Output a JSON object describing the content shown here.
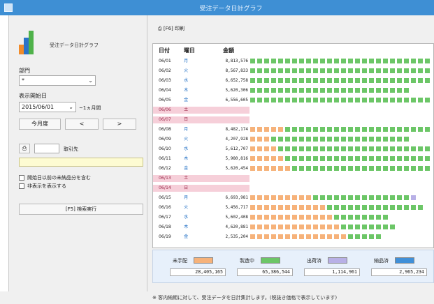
{
  "window": {
    "title": "受注データ日計グラフ"
  },
  "app": {
    "name": "受注データ日計グラフ"
  },
  "filters": {
    "dept_label": "部門",
    "dept_value": "*",
    "start_label": "表示開始日",
    "start_value": "2015/06/01",
    "period_suffix": "~1ヵ月間",
    "month_button": "今月度",
    "prev_button": "<",
    "next_button": ">",
    "client_label": "取引先",
    "option1": "開始日以前の未納品分を含む",
    "option2": "非表示を表示する",
    "search_button": "[F5] 検索実行"
  },
  "toolbar": {
    "print_label": "[F6] 印刷"
  },
  "grid": {
    "headers": {
      "date": "日付",
      "dow": "曜日",
      "amount": "金額"
    },
    "colors": {
      "orange": "#f6b27a",
      "green": "#6cc667",
      "purple": "#b8b0e6",
      "weekend_bg": "#f6cfd9",
      "weekday_text": "#1a6bc3",
      "sat_text": "#9b2b4c"
    },
    "rows": [
      {
        "date": "06/01",
        "dow": "月",
        "amount": "8,813,576",
        "weekend": false,
        "o": 0,
        "g": 26,
        "p": 0
      },
      {
        "date": "06/02",
        "dow": "火",
        "amount": "8,567,833",
        "weekend": false,
        "o": 0,
        "g": 26,
        "p": 0
      },
      {
        "date": "06/03",
        "dow": "水",
        "amount": "6,652,758",
        "weekend": false,
        "o": 0,
        "g": 26,
        "p": 0
      },
      {
        "date": "06/04",
        "dow": "木",
        "amount": "5,620,306",
        "weekend": false,
        "o": 0,
        "g": 23,
        "p": 0
      },
      {
        "date": "06/05",
        "dow": "金",
        "amount": "6,556,605",
        "weekend": false,
        "o": 0,
        "g": 26,
        "p": 0
      },
      {
        "date": "06/06",
        "dow": "土",
        "amount": "",
        "weekend": true,
        "o": 0,
        "g": 0,
        "p": 0
      },
      {
        "date": "06/07",
        "dow": "日",
        "amount": "",
        "weekend": true,
        "o": 0,
        "g": 0,
        "p": 0
      },
      {
        "date": "06/08",
        "dow": "月",
        "amount": "8,482,174",
        "weekend": false,
        "o": 5,
        "g": 21,
        "p": 0
      },
      {
        "date": "06/09",
        "dow": "火",
        "amount": "4,207,928",
        "weekend": false,
        "o": 3,
        "g": 20,
        "p": 0
      },
      {
        "date": "06/10",
        "dow": "水",
        "amount": "5,612,707",
        "weekend": false,
        "o": 4,
        "g": 22,
        "p": 0
      },
      {
        "date": "06/11",
        "dow": "木",
        "amount": "5,980,816",
        "weekend": false,
        "o": 5,
        "g": 21,
        "p": 0
      },
      {
        "date": "06/12",
        "dow": "金",
        "amount": "5,620,454",
        "weekend": false,
        "o": 6,
        "g": 20,
        "p": 0
      },
      {
        "date": "06/13",
        "dow": "土",
        "amount": "",
        "weekend": true,
        "o": 0,
        "g": 0,
        "p": 0
      },
      {
        "date": "06/14",
        "dow": "日",
        "amount": "",
        "weekend": true,
        "o": 0,
        "g": 0,
        "p": 0
      },
      {
        "date": "06/15",
        "dow": "月",
        "amount": "6,693,981",
        "weekend": false,
        "o": 9,
        "g": 14,
        "p": 1
      },
      {
        "date": "06/16",
        "dow": "火",
        "amount": "5,456,717",
        "weekend": false,
        "o": 11,
        "g": 14,
        "p": 0
      },
      {
        "date": "06/17",
        "dow": "水",
        "amount": "5,602,408",
        "weekend": false,
        "o": 12,
        "g": 8,
        "p": 0
      },
      {
        "date": "06/18",
        "dow": "木",
        "amount": "4,620,881",
        "weekend": false,
        "o": 13,
        "g": 8,
        "p": 0
      },
      {
        "date": "06/19",
        "dow": "金",
        "amount": "2,535,204",
        "weekend": false,
        "o": 14,
        "g": 5,
        "p": 0
      }
    ]
  },
  "legend": [
    {
      "label": "未手配",
      "color": "#f6b27a",
      "value": "28,405,165"
    },
    {
      "label": "製造中",
      "color": "#6cc667",
      "value": "65,386,544"
    },
    {
      "label": "出荷済",
      "color": "#b8b0e6",
      "value": "1,114,961"
    },
    {
      "label": "納品済",
      "color": "#3f8fd8",
      "value": "2,965,234"
    }
  ],
  "footer": {
    "note": "※ 客内納期に対して、受注データを日計集計します。(税抜き価格で表示しています)"
  }
}
